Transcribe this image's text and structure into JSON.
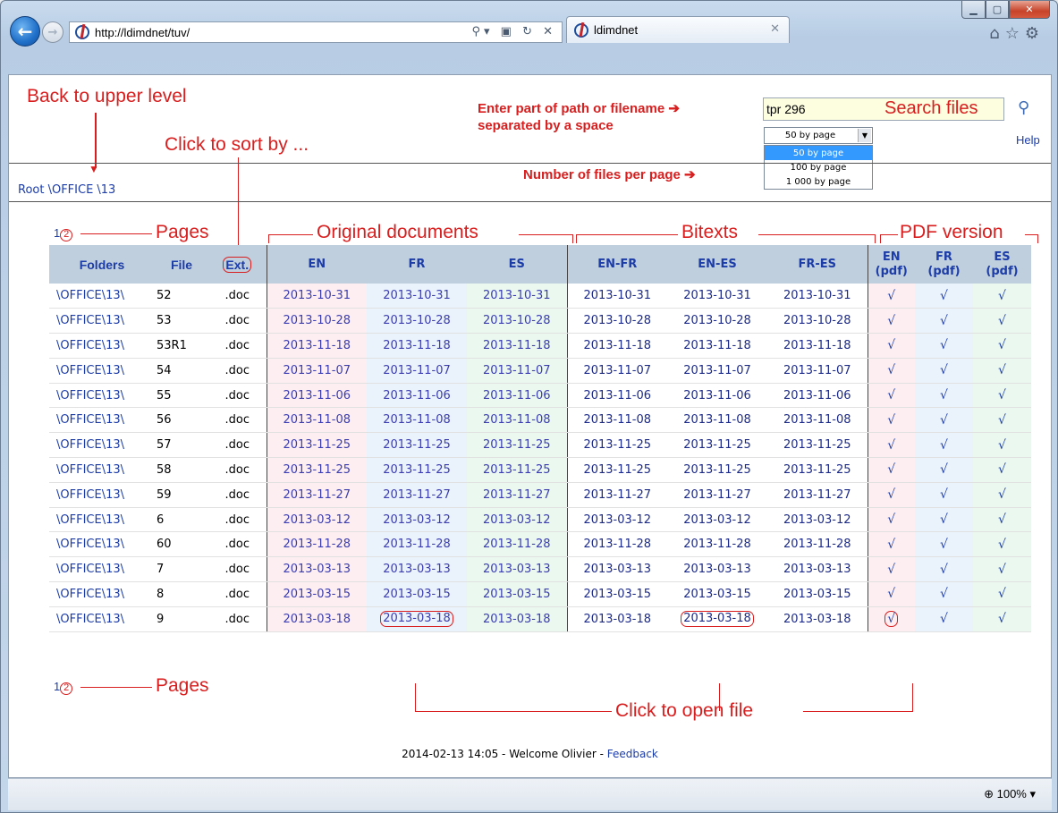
{
  "browser": {
    "url": "http://ldimdnet/tuv/",
    "tab_title": "ldimdnet",
    "zoom": "100%"
  },
  "annotations": {
    "back_to_upper": "Back to upper level",
    "click_to_sort": "Click to sort by ...",
    "enter_part": "Enter part of path or filename",
    "separated": "separated by a space",
    "search_files": "Search files",
    "files_per_page": "Number of files per page",
    "pages": "Pages",
    "original_documents": "Original documents",
    "bitexts": "Bitexts",
    "pdf_version": "PDF version",
    "click_to_open": "Click to open file"
  },
  "breadcrumb": "Root \\OFFICE \\13",
  "search": {
    "value": "tpr 296"
  },
  "help": "Help",
  "per_page": {
    "selected": "50 by page",
    "options": [
      "50 by page",
      "100 by page",
      "1 000 by page"
    ]
  },
  "pager": {
    "first": "1",
    "current": "2"
  },
  "table": {
    "headers": {
      "folders": "Folders",
      "file": "File",
      "ext": "Ext.",
      "en": "EN",
      "fr": "FR",
      "es": "ES",
      "en_fr": "EN-FR",
      "en_es": "EN-ES",
      "fr_es": "FR-ES",
      "en_pdf_1": "EN",
      "en_pdf_2": "(pdf)",
      "fr_pdf_1": "FR",
      "fr_pdf_2": "(pdf)",
      "es_pdf_1": "ES",
      "es_pdf_2": "(pdf)"
    },
    "check": "√",
    "rows": [
      {
        "folder": "\\OFFICE\\13\\",
        "file": "52",
        "ext": ".doc",
        "date": "2013-10-31"
      },
      {
        "folder": "\\OFFICE\\13\\",
        "file": "53",
        "ext": ".doc",
        "date": "2013-10-28"
      },
      {
        "folder": "\\OFFICE\\13\\",
        "file": "53R1",
        "ext": ".doc",
        "date": "2013-11-18"
      },
      {
        "folder": "\\OFFICE\\13\\",
        "file": "54",
        "ext": ".doc",
        "date": "2013-11-07"
      },
      {
        "folder": "\\OFFICE\\13\\",
        "file": "55",
        "ext": ".doc",
        "date": "2013-11-06"
      },
      {
        "folder": "\\OFFICE\\13\\",
        "file": "56",
        "ext": ".doc",
        "date": "2013-11-08"
      },
      {
        "folder": "\\OFFICE\\13\\",
        "file": "57",
        "ext": ".doc",
        "date": "2013-11-25"
      },
      {
        "folder": "\\OFFICE\\13\\",
        "file": "58",
        "ext": ".doc",
        "date": "2013-11-25"
      },
      {
        "folder": "\\OFFICE\\13\\",
        "file": "59",
        "ext": ".doc",
        "date": "2013-11-27"
      },
      {
        "folder": "\\OFFICE\\13\\",
        "file": "6",
        "ext": ".doc",
        "date": "2013-03-12"
      },
      {
        "folder": "\\OFFICE\\13\\",
        "file": "60",
        "ext": ".doc",
        "date": "2013-11-28"
      },
      {
        "folder": "\\OFFICE\\13\\",
        "file": "7",
        "ext": ".doc",
        "date": "2013-03-13"
      },
      {
        "folder": "\\OFFICE\\13\\",
        "file": "8",
        "ext": ".doc",
        "date": "2013-03-15"
      },
      {
        "folder": "\\OFFICE\\13\\",
        "file": "9",
        "ext": ".doc",
        "date": "2013-03-18"
      }
    ]
  },
  "footer": {
    "text": "2014-02-13 14:05 - Welcome Olivier - ",
    "feedback": "Feedback"
  }
}
